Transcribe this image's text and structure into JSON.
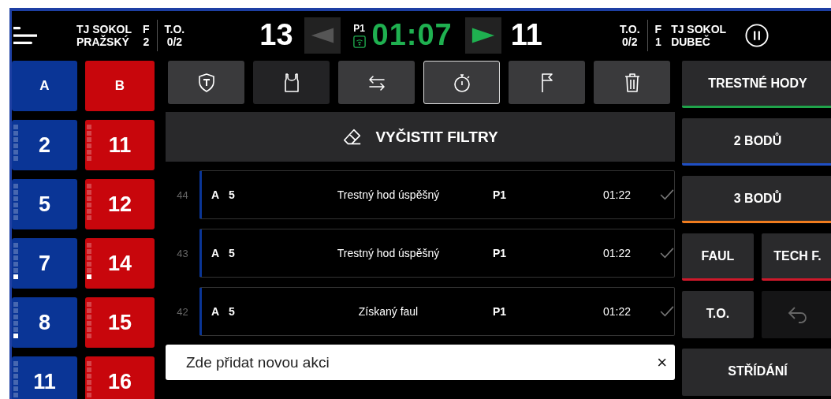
{
  "header": {
    "home": {
      "name": [
        "TJ SOKOL",
        "PRAŽSKÝ"
      ],
      "fouls_label": "F",
      "fouls": "2",
      "timeouts_label": "T.O.",
      "timeouts": "0/2",
      "score": "13"
    },
    "period": "P1",
    "clock": "01:07",
    "prev_enabled": false,
    "next_enabled": true,
    "away": {
      "name": [
        "TJ SOKOL",
        "DUBEČ"
      ],
      "fouls_label": "F",
      "fouls": "1",
      "timeouts_label": "T.O.",
      "timeouts": "0/2",
      "score": "11"
    }
  },
  "teams": [
    {
      "label": "A",
      "color": "#0a3596",
      "players": [
        {
          "number": "2",
          "fouled": false
        },
        {
          "number": "5",
          "fouled": false
        },
        {
          "number": "7",
          "fouled": true
        },
        {
          "number": "8",
          "fouled": true
        },
        {
          "number": "11",
          "fouled": false
        }
      ]
    },
    {
      "label": "B",
      "color": "#c8060c",
      "players": [
        {
          "number": "11",
          "fouled": false
        },
        {
          "number": "12",
          "fouled": false
        },
        {
          "number": "14",
          "fouled": true
        },
        {
          "number": "15",
          "fouled": false
        },
        {
          "number": "16",
          "fouled": false
        }
      ]
    }
  ],
  "tools": [
    {
      "kind": "shield",
      "selected": false,
      "dimmed": false
    },
    {
      "kind": "jersey",
      "selected": false,
      "dimmed": true
    },
    {
      "kind": "swap",
      "selected": false,
      "dimmed": false
    },
    {
      "kind": "stopwatch",
      "selected": true,
      "dimmed": false
    },
    {
      "kind": "flag",
      "selected": false,
      "dimmed": false
    },
    {
      "kind": "trash",
      "selected": false,
      "dimmed": false
    }
  ],
  "clear_filters": "VYČISTIT FILTRY",
  "events": [
    {
      "index": "44",
      "team": "A",
      "player": "5",
      "action": "Trestný hod úspěšný",
      "period": "P1",
      "time": "01:22",
      "color": "#0a3596"
    },
    {
      "index": "43",
      "team": "A",
      "player": "5",
      "action": "Trestný hod úspěšný",
      "period": "P1",
      "time": "01:22",
      "color": "#0a3596"
    },
    {
      "index": "42",
      "team": "A",
      "player": "5",
      "action": "Získaný faul",
      "period": "P1",
      "time": "01:22",
      "color": "#0a3596"
    }
  ],
  "new_action": {
    "placeholder": "Zde přidat novou akci",
    "clear": "×"
  },
  "actions": [
    {
      "kind": "wide",
      "label": "TRESTNÉ HODY",
      "color": "#1fa34a"
    },
    {
      "kind": "wide",
      "label": "2 BODŮ",
      "color": "#1f4fc4"
    },
    {
      "kind": "wide",
      "label": "3 BODŮ",
      "color": "#f07c1e"
    },
    {
      "kind": "half",
      "label": "FAUL",
      "color": "#d0182a"
    },
    {
      "kind": "half",
      "label": "TECH F.",
      "color": "#d0182a"
    },
    {
      "kind": "half",
      "label": "T.O."
    },
    {
      "kind": "undo",
      "disabled": true
    },
    {
      "kind": "wide",
      "label": "STŘÍDÁNÍ"
    }
  ]
}
